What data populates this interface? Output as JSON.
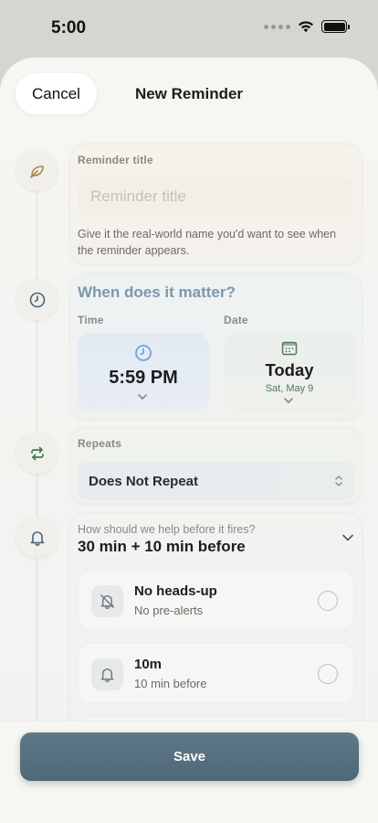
{
  "status_bar": {
    "time": "5:00"
  },
  "header": {
    "cancel_label": "Cancel",
    "title": "New Reminder"
  },
  "title_card": {
    "label": "Reminder title",
    "placeholder": "Reminder title",
    "value": "",
    "helper": "Give it the real-world name you'd want to see when the reminder appears."
  },
  "when_card": {
    "heading": "When does it matter?",
    "time_label": "Time",
    "time_value": "5:59 PM",
    "date_label": "Date",
    "date_value": "Today",
    "date_sub": "Sat, May 9"
  },
  "repeats_card": {
    "label": "Repeats",
    "selected": "Does Not Repeat"
  },
  "alerts_card": {
    "question": "How should we help before it fires?",
    "summary": "30 min + 10 min before",
    "options": [
      {
        "title": "No heads-up",
        "subtitle": "No pre-alerts",
        "icon": "bell-slash-icon",
        "selected": false
      },
      {
        "title": "10m",
        "subtitle": "10 min before",
        "icon": "bell-icon",
        "selected": false
      }
    ]
  },
  "footer": {
    "save_label": "Save"
  },
  "colors": {
    "accent_blue": "#7d97ab",
    "save_button": "#546e7c",
    "date_sub_green": "#4f7a5a",
    "repeat_icon_green": "#3f7a4e",
    "leaf_icon_gold": "#a6874a"
  }
}
